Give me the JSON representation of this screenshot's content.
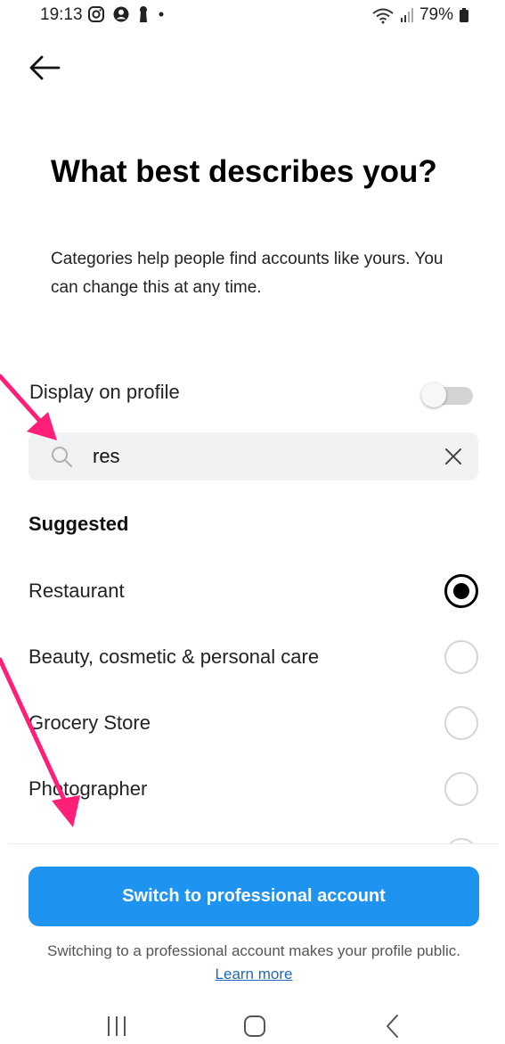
{
  "status": {
    "time": "19:13",
    "battery": "79%"
  },
  "page": {
    "title": "What best describes you?",
    "subtitle": "Categories help people find accounts like yours. You can change this at any time."
  },
  "display_toggle": {
    "label": "Display on profile",
    "on": false
  },
  "search": {
    "value": "res"
  },
  "suggested_heading": "Suggested",
  "categories": [
    {
      "label": "Restaurant",
      "selected": true
    },
    {
      "label": "Beauty, cosmetic & personal care",
      "selected": false
    },
    {
      "label": "Grocery Store",
      "selected": false
    },
    {
      "label": "Photographer",
      "selected": false
    }
  ],
  "footer": {
    "button_label": "Switch to professional account",
    "note": "Switching to a professional account makes your profile public.",
    "learn_more": "Learn more"
  },
  "colors": {
    "accent": "#1e93ef",
    "annotation": "#ff1e78",
    "link": "#1f69b4"
  },
  "icons": {
    "back": "arrow-left-icon",
    "search": "search-icon",
    "clear": "close-icon",
    "nav_recents": "recent-apps-icon",
    "nav_home": "home-icon",
    "nav_back": "chevron-left-icon"
  }
}
